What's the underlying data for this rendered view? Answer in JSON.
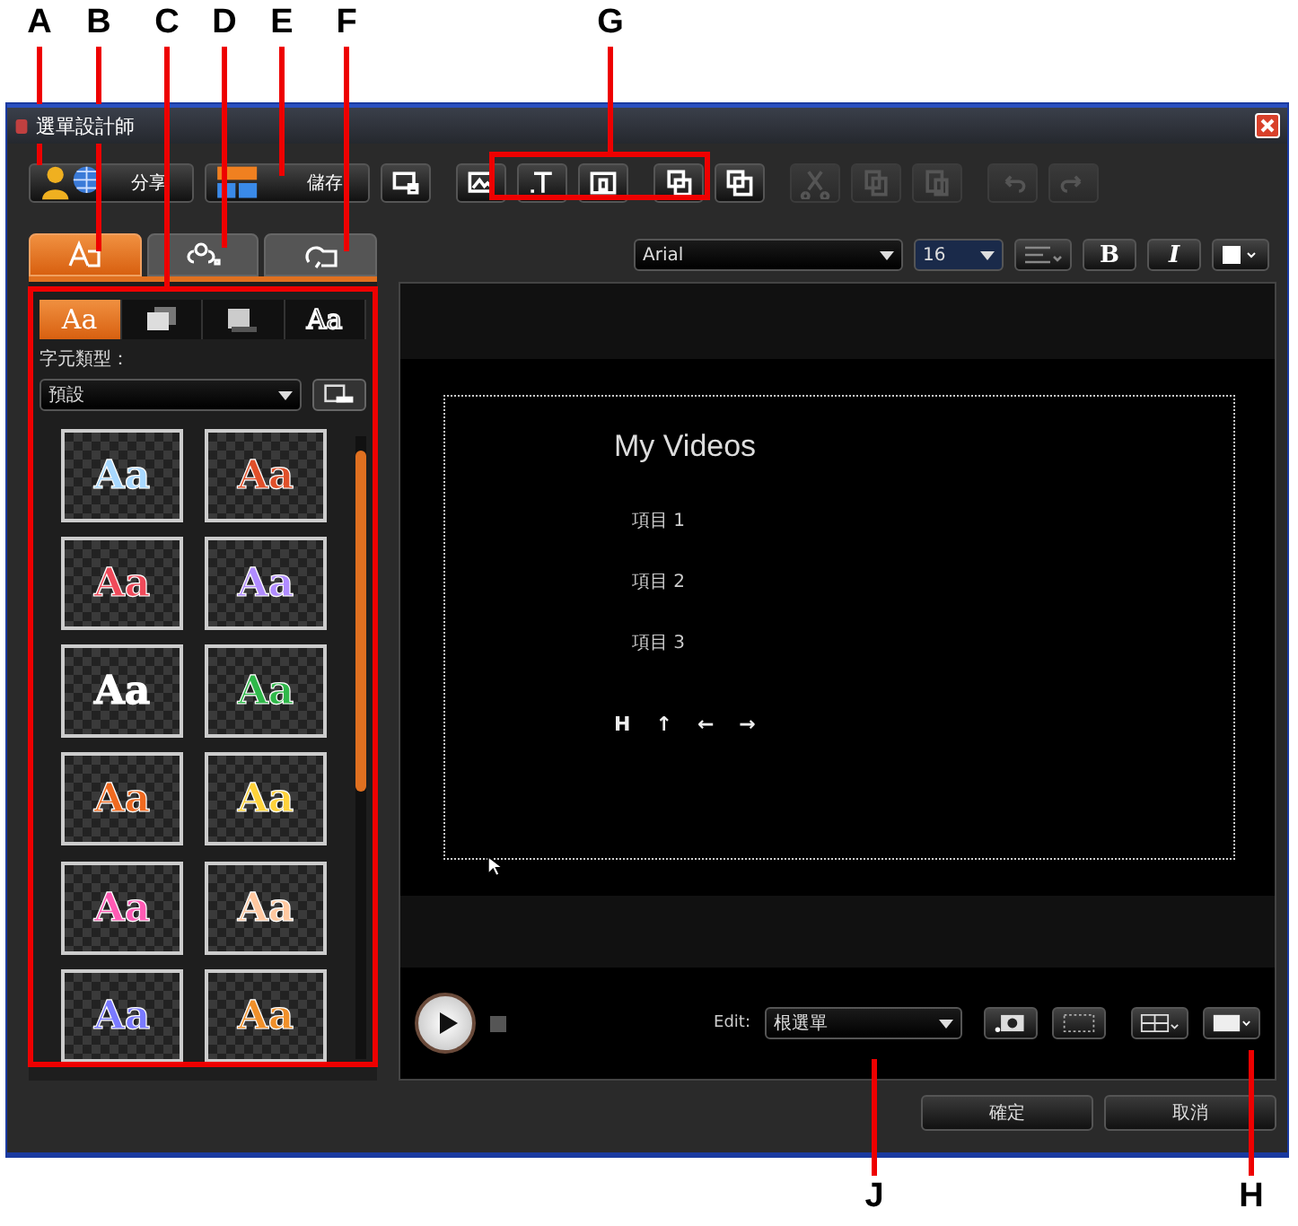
{
  "callouts": [
    {
      "letter": "A"
    },
    {
      "letter": "B"
    },
    {
      "letter": "C"
    },
    {
      "letter": "D"
    },
    {
      "letter": "E"
    },
    {
      "letter": "F"
    },
    {
      "letter": "G"
    },
    {
      "letter": "J"
    },
    {
      "letter": "H"
    }
  ],
  "window": {
    "title": "選單設計師"
  },
  "toolbar": [
    {
      "kind": "share",
      "label": "分享",
      "disabled": false
    },
    {
      "kind": "save",
      "label": "儲存",
      "disabled": false
    },
    {
      "kind": "background",
      "disabled": false
    },
    {
      "kind": "image",
      "disabled": false
    },
    {
      "kind": "text",
      "disabled": false
    },
    {
      "kind": "object",
      "disabled": false
    },
    {
      "kind": "front",
      "disabled": false
    },
    {
      "kind": "back",
      "disabled": false
    },
    {
      "kind": "cut",
      "disabled": true
    },
    {
      "kind": "copy",
      "disabled": true
    },
    {
      "kind": "paste",
      "disabled": true
    },
    {
      "kind": "undo",
      "disabled": true
    },
    {
      "kind": "redo",
      "disabled": true
    }
  ],
  "tabs": [
    {
      "kind": "text",
      "selected": true
    },
    {
      "kind": "effects",
      "selected": false
    },
    {
      "kind": "motion",
      "selected": false
    }
  ],
  "format_bar": {
    "font": "Arial",
    "size": "16",
    "bold": "B",
    "italic": "I"
  },
  "style_tabs": [
    {
      "kind": "letters",
      "label": "Aa",
      "selected": true
    },
    {
      "kind": "shadow",
      "selected": false
    },
    {
      "kind": "border",
      "selected": false
    },
    {
      "kind": "outline",
      "label": "Aa",
      "selected": false
    }
  ],
  "style_panel": {
    "type_label": "字元類型：",
    "type_value": "預設",
    "presets": [
      {
        "label": "Aa",
        "color": "#a8d8ff"
      },
      {
        "label": "Aa",
        "color": "#e0502a"
      },
      {
        "label": "Aa",
        "color": "#f04a5a"
      },
      {
        "label": "Aa",
        "color": "#b08cff"
      },
      {
        "label": "Aa",
        "color": "#ffffff"
      },
      {
        "label": "Aa",
        "color": "#2fb84a"
      },
      {
        "label": "Aa",
        "color": "#f06a20"
      },
      {
        "label": "Aa",
        "color": "#ffd23a"
      },
      {
        "label": "Aa",
        "color": "#ff5ab4"
      },
      {
        "label": "Aa",
        "color": "#ffc8a0"
      },
      {
        "label": "Aa",
        "color": "#7a7aff"
      },
      {
        "label": "Aa",
        "color": "#f0902a"
      }
    ]
  },
  "preview": {
    "title": "My Videos",
    "items": [
      "項目 1",
      "項目 2",
      "項目 3"
    ],
    "nav": [
      "H",
      "↑",
      "←",
      "→"
    ]
  },
  "playback": {
    "edit_label": "Edit:",
    "edit_value": "根選單"
  },
  "buttons": [
    "確定",
    "取消"
  ]
}
